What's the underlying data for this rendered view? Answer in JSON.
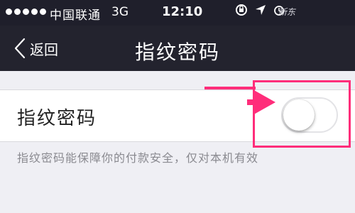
{
  "status_bar": {
    "signal_dots": 5,
    "carrier": "中国联通",
    "network": "3G",
    "time": "12:10",
    "icons": [
      "rotation-lock-icon",
      "location-arrow-icon",
      "alarm-icon"
    ],
    "watermark": "新东"
  },
  "nav": {
    "back_label": "返回",
    "back_icon": "chevron-left-icon",
    "title": "指纹密码"
  },
  "settings": {
    "fingerprint_row": {
      "label": "指纹密码",
      "toggle_on": false
    },
    "description": "指纹密码能保障你的付款安全，仅对本机有效"
  },
  "annotation": {
    "highlight_color": "#ff2d7a",
    "arrow_icon": "pointer-arrow-icon"
  },
  "colors": {
    "status_bar_bg": "#1f1f2b",
    "nav_bg": "#23232e",
    "page_bg": "#efeff4",
    "row_bg": "#ffffff",
    "description_text": "#8a8a90"
  }
}
